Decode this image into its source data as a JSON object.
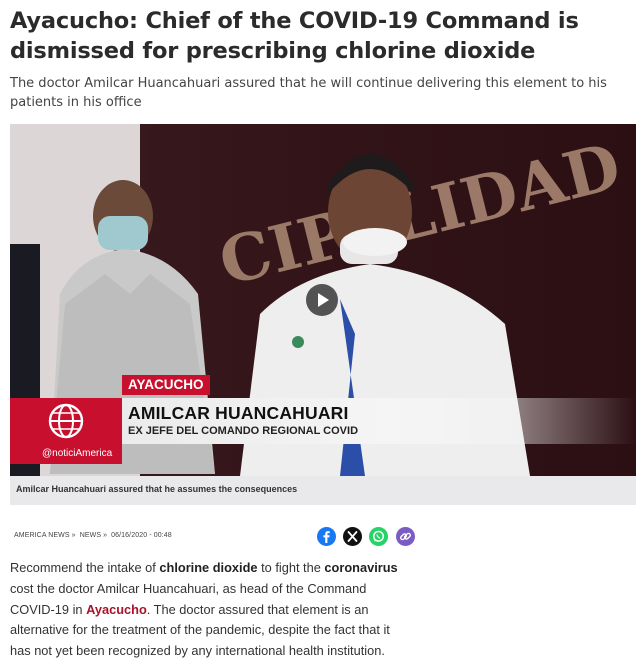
{
  "article": {
    "headline": "Ayacucho: Chief of the COVID-19 Command is dismissed for prescribing chlorine dioxide",
    "subtitle": "The doctor Amilcar Huancahuari assured that he will continue delivering this element to his patients in his office"
  },
  "video": {
    "location_tag": "AYACUCHO",
    "name": "AMILCAR HUANCAHUARI",
    "role": "EX JEFE DEL COMANDO REGIONAL COVID",
    "brand_handle": "@noticiAmerica",
    "wall_text": "CIPALIDAD DIS",
    "caption": "Amilcar Huancahuari assured that he assumes the consequences"
  },
  "meta": {
    "crumb_1": "AMERICA NEWS",
    "crumb_2": "NEWS",
    "date": "06/16/2020 - 00:48",
    "separator": "»"
  },
  "share": [
    {
      "icon": "facebook-icon",
      "color": "#1877f2"
    },
    {
      "icon": "x-icon",
      "color": "#111111"
    },
    {
      "icon": "whatsapp-icon",
      "color": "#25d366"
    },
    {
      "icon": "link-icon",
      "color": "#7b5cc4"
    }
  ],
  "body": {
    "p1_a": "Recommend the intake of ",
    "p1_b": "chlorine dioxide",
    "p1_c": " to fight the ",
    "p1_d": "coronavirus",
    "p1_e": " cost the doctor Amilcar Huancahuari, as head of the Command COVID-19 in ",
    "p1_f": "Ayacucho",
    "p1_g": ". The doctor assured that element is an alternative for the treatment of the pandemic, despite the fact that it has not yet been recognized by any international health institution."
  },
  "colors": {
    "brand_red": "#c8102e",
    "link_red": "#a8132a"
  }
}
